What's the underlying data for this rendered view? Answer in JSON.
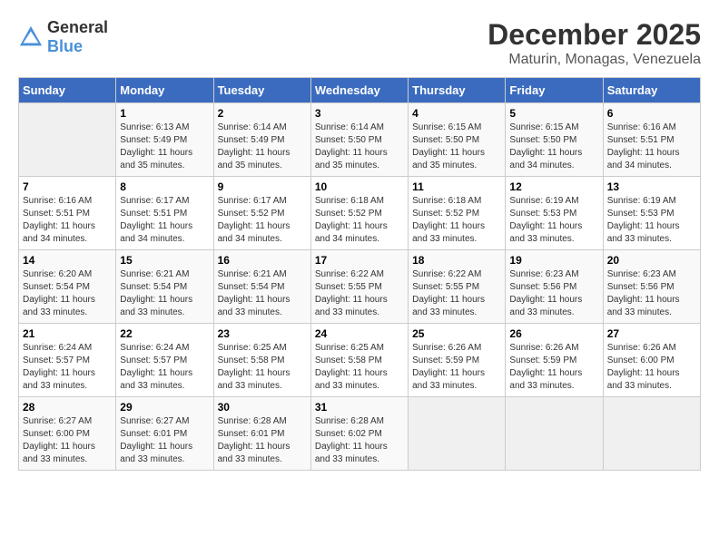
{
  "logo": {
    "general": "General",
    "blue": "Blue"
  },
  "header": {
    "month_year": "December 2025",
    "location": "Maturin, Monagas, Venezuela"
  },
  "days_of_week": [
    "Sunday",
    "Monday",
    "Tuesday",
    "Wednesday",
    "Thursday",
    "Friday",
    "Saturday"
  ],
  "weeks": [
    [
      {
        "day": "",
        "sunrise": "",
        "sunset": "",
        "daylight": "",
        "empty": true
      },
      {
        "day": "1",
        "sunrise": "Sunrise: 6:13 AM",
        "sunset": "Sunset: 5:49 PM",
        "daylight": "Daylight: 11 hours and 35 minutes."
      },
      {
        "day": "2",
        "sunrise": "Sunrise: 6:14 AM",
        "sunset": "Sunset: 5:49 PM",
        "daylight": "Daylight: 11 hours and 35 minutes."
      },
      {
        "day": "3",
        "sunrise": "Sunrise: 6:14 AM",
        "sunset": "Sunset: 5:50 PM",
        "daylight": "Daylight: 11 hours and 35 minutes."
      },
      {
        "day": "4",
        "sunrise": "Sunrise: 6:15 AM",
        "sunset": "Sunset: 5:50 PM",
        "daylight": "Daylight: 11 hours and 35 minutes."
      },
      {
        "day": "5",
        "sunrise": "Sunrise: 6:15 AM",
        "sunset": "Sunset: 5:50 PM",
        "daylight": "Daylight: 11 hours and 34 minutes."
      },
      {
        "day": "6",
        "sunrise": "Sunrise: 6:16 AM",
        "sunset": "Sunset: 5:51 PM",
        "daylight": "Daylight: 11 hours and 34 minutes."
      }
    ],
    [
      {
        "day": "7",
        "sunrise": "Sunrise: 6:16 AM",
        "sunset": "Sunset: 5:51 PM",
        "daylight": "Daylight: 11 hours and 34 minutes."
      },
      {
        "day": "8",
        "sunrise": "Sunrise: 6:17 AM",
        "sunset": "Sunset: 5:51 PM",
        "daylight": "Daylight: 11 hours and 34 minutes."
      },
      {
        "day": "9",
        "sunrise": "Sunrise: 6:17 AM",
        "sunset": "Sunset: 5:52 PM",
        "daylight": "Daylight: 11 hours and 34 minutes."
      },
      {
        "day": "10",
        "sunrise": "Sunrise: 6:18 AM",
        "sunset": "Sunset: 5:52 PM",
        "daylight": "Daylight: 11 hours and 34 minutes."
      },
      {
        "day": "11",
        "sunrise": "Sunrise: 6:18 AM",
        "sunset": "Sunset: 5:52 PM",
        "daylight": "Daylight: 11 hours and 33 minutes."
      },
      {
        "day": "12",
        "sunrise": "Sunrise: 6:19 AM",
        "sunset": "Sunset: 5:53 PM",
        "daylight": "Daylight: 11 hours and 33 minutes."
      },
      {
        "day": "13",
        "sunrise": "Sunrise: 6:19 AM",
        "sunset": "Sunset: 5:53 PM",
        "daylight": "Daylight: 11 hours and 33 minutes."
      }
    ],
    [
      {
        "day": "14",
        "sunrise": "Sunrise: 6:20 AM",
        "sunset": "Sunset: 5:54 PM",
        "daylight": "Daylight: 11 hours and 33 minutes."
      },
      {
        "day": "15",
        "sunrise": "Sunrise: 6:21 AM",
        "sunset": "Sunset: 5:54 PM",
        "daylight": "Daylight: 11 hours and 33 minutes."
      },
      {
        "day": "16",
        "sunrise": "Sunrise: 6:21 AM",
        "sunset": "Sunset: 5:54 PM",
        "daylight": "Daylight: 11 hours and 33 minutes."
      },
      {
        "day": "17",
        "sunrise": "Sunrise: 6:22 AM",
        "sunset": "Sunset: 5:55 PM",
        "daylight": "Daylight: 11 hours and 33 minutes."
      },
      {
        "day": "18",
        "sunrise": "Sunrise: 6:22 AM",
        "sunset": "Sunset: 5:55 PM",
        "daylight": "Daylight: 11 hours and 33 minutes."
      },
      {
        "day": "19",
        "sunrise": "Sunrise: 6:23 AM",
        "sunset": "Sunset: 5:56 PM",
        "daylight": "Daylight: 11 hours and 33 minutes."
      },
      {
        "day": "20",
        "sunrise": "Sunrise: 6:23 AM",
        "sunset": "Sunset: 5:56 PM",
        "daylight": "Daylight: 11 hours and 33 minutes."
      }
    ],
    [
      {
        "day": "21",
        "sunrise": "Sunrise: 6:24 AM",
        "sunset": "Sunset: 5:57 PM",
        "daylight": "Daylight: 11 hours and 33 minutes."
      },
      {
        "day": "22",
        "sunrise": "Sunrise: 6:24 AM",
        "sunset": "Sunset: 5:57 PM",
        "daylight": "Daylight: 11 hours and 33 minutes."
      },
      {
        "day": "23",
        "sunrise": "Sunrise: 6:25 AM",
        "sunset": "Sunset: 5:58 PM",
        "daylight": "Daylight: 11 hours and 33 minutes."
      },
      {
        "day": "24",
        "sunrise": "Sunrise: 6:25 AM",
        "sunset": "Sunset: 5:58 PM",
        "daylight": "Daylight: 11 hours and 33 minutes."
      },
      {
        "day": "25",
        "sunrise": "Sunrise: 6:26 AM",
        "sunset": "Sunset: 5:59 PM",
        "daylight": "Daylight: 11 hours and 33 minutes."
      },
      {
        "day": "26",
        "sunrise": "Sunrise: 6:26 AM",
        "sunset": "Sunset: 5:59 PM",
        "daylight": "Daylight: 11 hours and 33 minutes."
      },
      {
        "day": "27",
        "sunrise": "Sunrise: 6:26 AM",
        "sunset": "Sunset: 6:00 PM",
        "daylight": "Daylight: 11 hours and 33 minutes."
      }
    ],
    [
      {
        "day": "28",
        "sunrise": "Sunrise: 6:27 AM",
        "sunset": "Sunset: 6:00 PM",
        "daylight": "Daylight: 11 hours and 33 minutes."
      },
      {
        "day": "29",
        "sunrise": "Sunrise: 6:27 AM",
        "sunset": "Sunset: 6:01 PM",
        "daylight": "Daylight: 11 hours and 33 minutes."
      },
      {
        "day": "30",
        "sunrise": "Sunrise: 6:28 AM",
        "sunset": "Sunset: 6:01 PM",
        "daylight": "Daylight: 11 hours and 33 minutes."
      },
      {
        "day": "31",
        "sunrise": "Sunrise: 6:28 AM",
        "sunset": "Sunset: 6:02 PM",
        "daylight": "Daylight: 11 hours and 33 minutes."
      },
      {
        "day": "",
        "sunrise": "",
        "sunset": "",
        "daylight": "",
        "empty": true
      },
      {
        "day": "",
        "sunrise": "",
        "sunset": "",
        "daylight": "",
        "empty": true
      },
      {
        "day": "",
        "sunrise": "",
        "sunset": "",
        "daylight": "",
        "empty": true
      }
    ]
  ]
}
